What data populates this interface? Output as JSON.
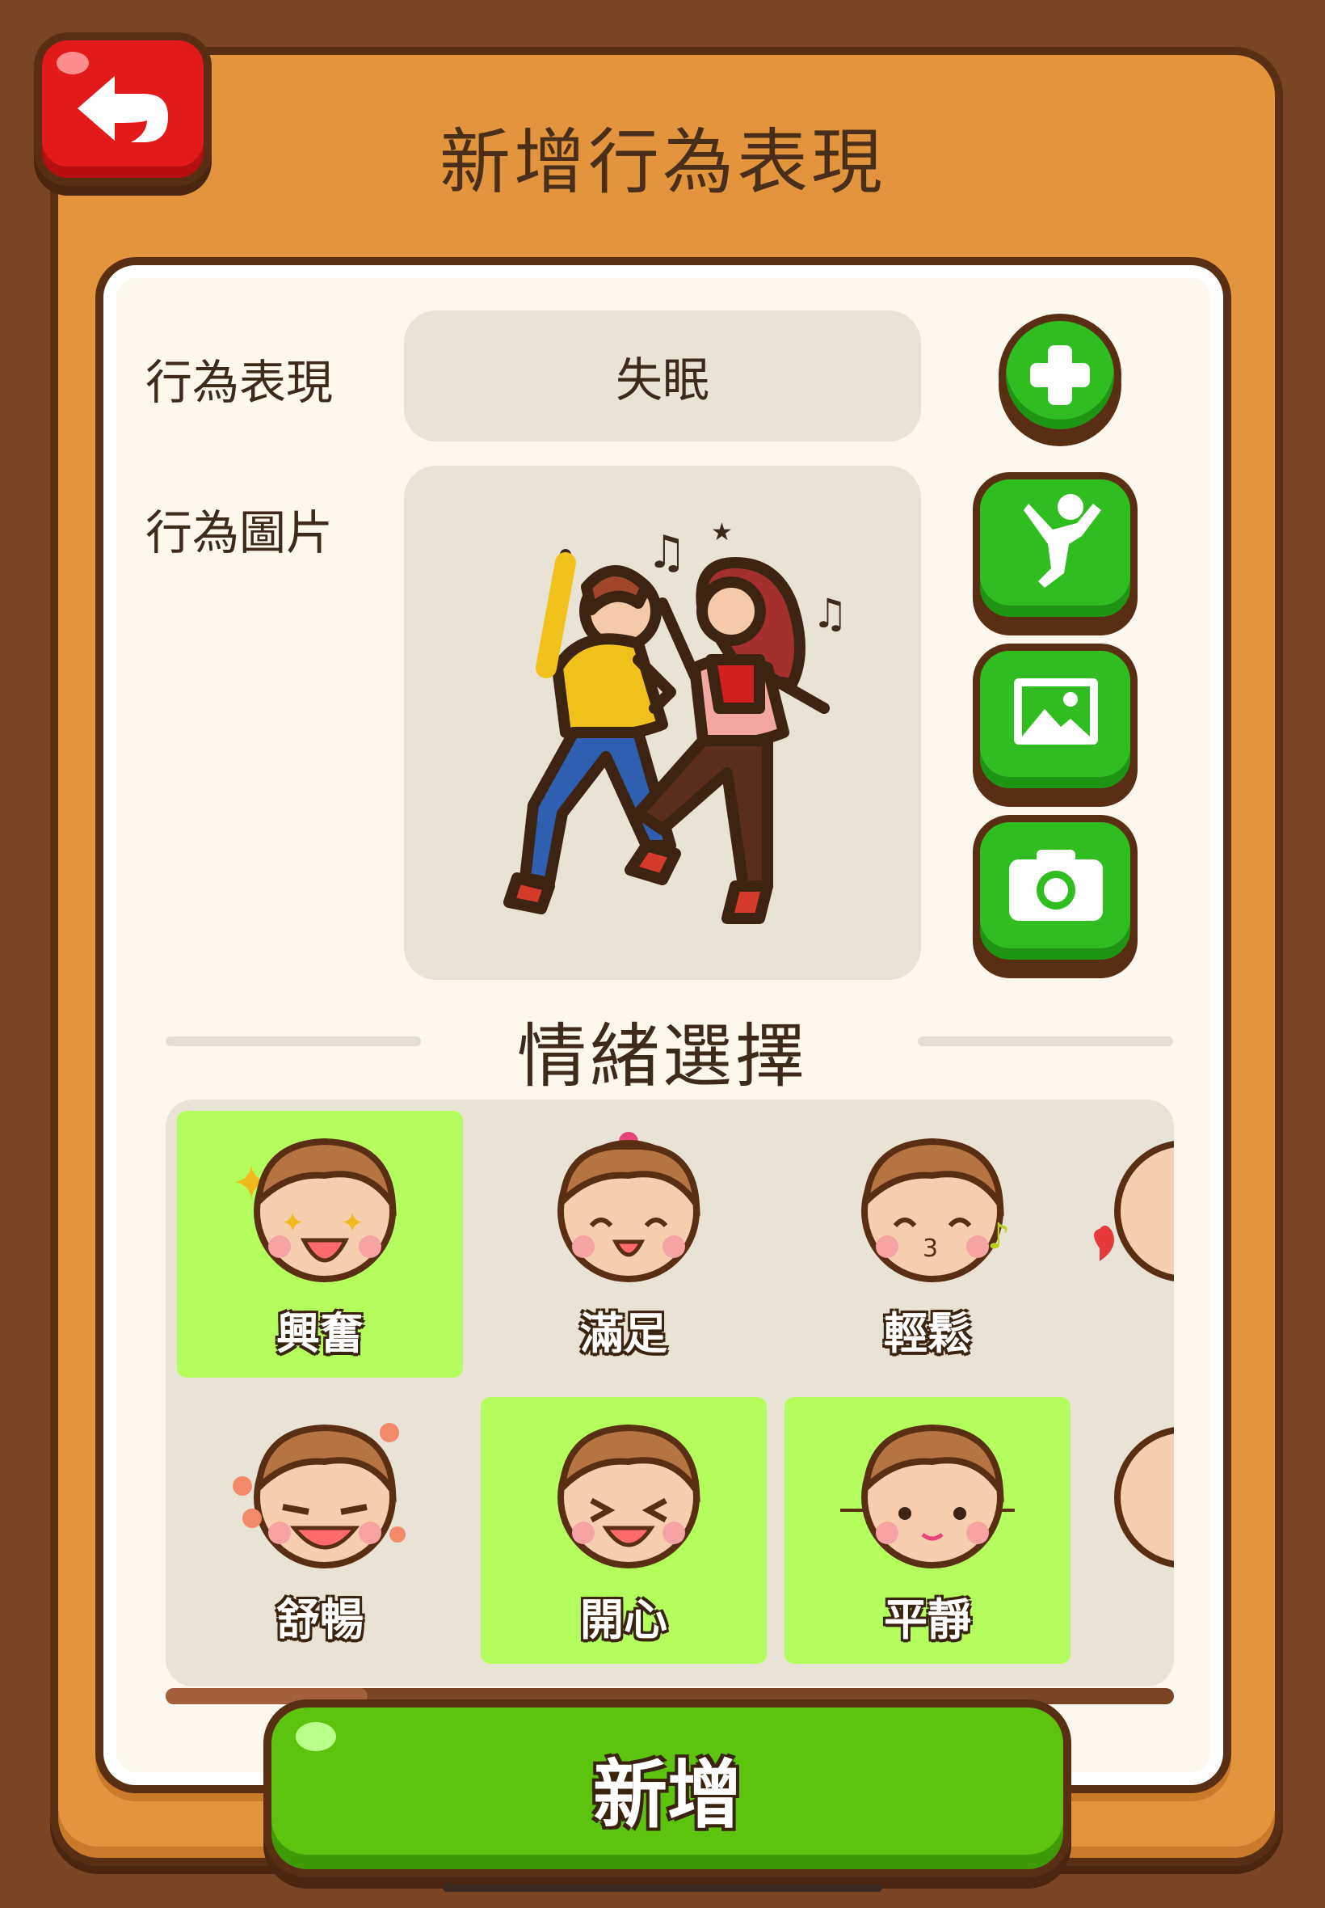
{
  "header": {
    "title": "新增行為表現",
    "back_icon": "back-arrow-icon"
  },
  "form": {
    "behavior_label": "行為表現",
    "behavior_value": "失眠",
    "image_label": "行為圖片",
    "image_subject": "dancing-couple-illustration"
  },
  "side_buttons": [
    "add-icon",
    "person-pose-icon",
    "gallery-icon",
    "camera-icon"
  ],
  "emotion_section": {
    "title": "情緒選擇",
    "items": [
      {
        "label": "興奮",
        "selected": true
      },
      {
        "label": "滿足",
        "selected": false
      },
      {
        "label": "輕鬆",
        "selected": false
      },
      {
        "label": "舒暢",
        "selected": false
      },
      {
        "label": "開心",
        "selected": true
      },
      {
        "label": "平靜",
        "selected": true
      }
    ]
  },
  "submit": {
    "label": "新增"
  },
  "colors": {
    "accent_green": "#2fbd1f",
    "selected_bg": "#b4ff5e",
    "board": "#e3953e",
    "back_red": "#e21a1a"
  }
}
